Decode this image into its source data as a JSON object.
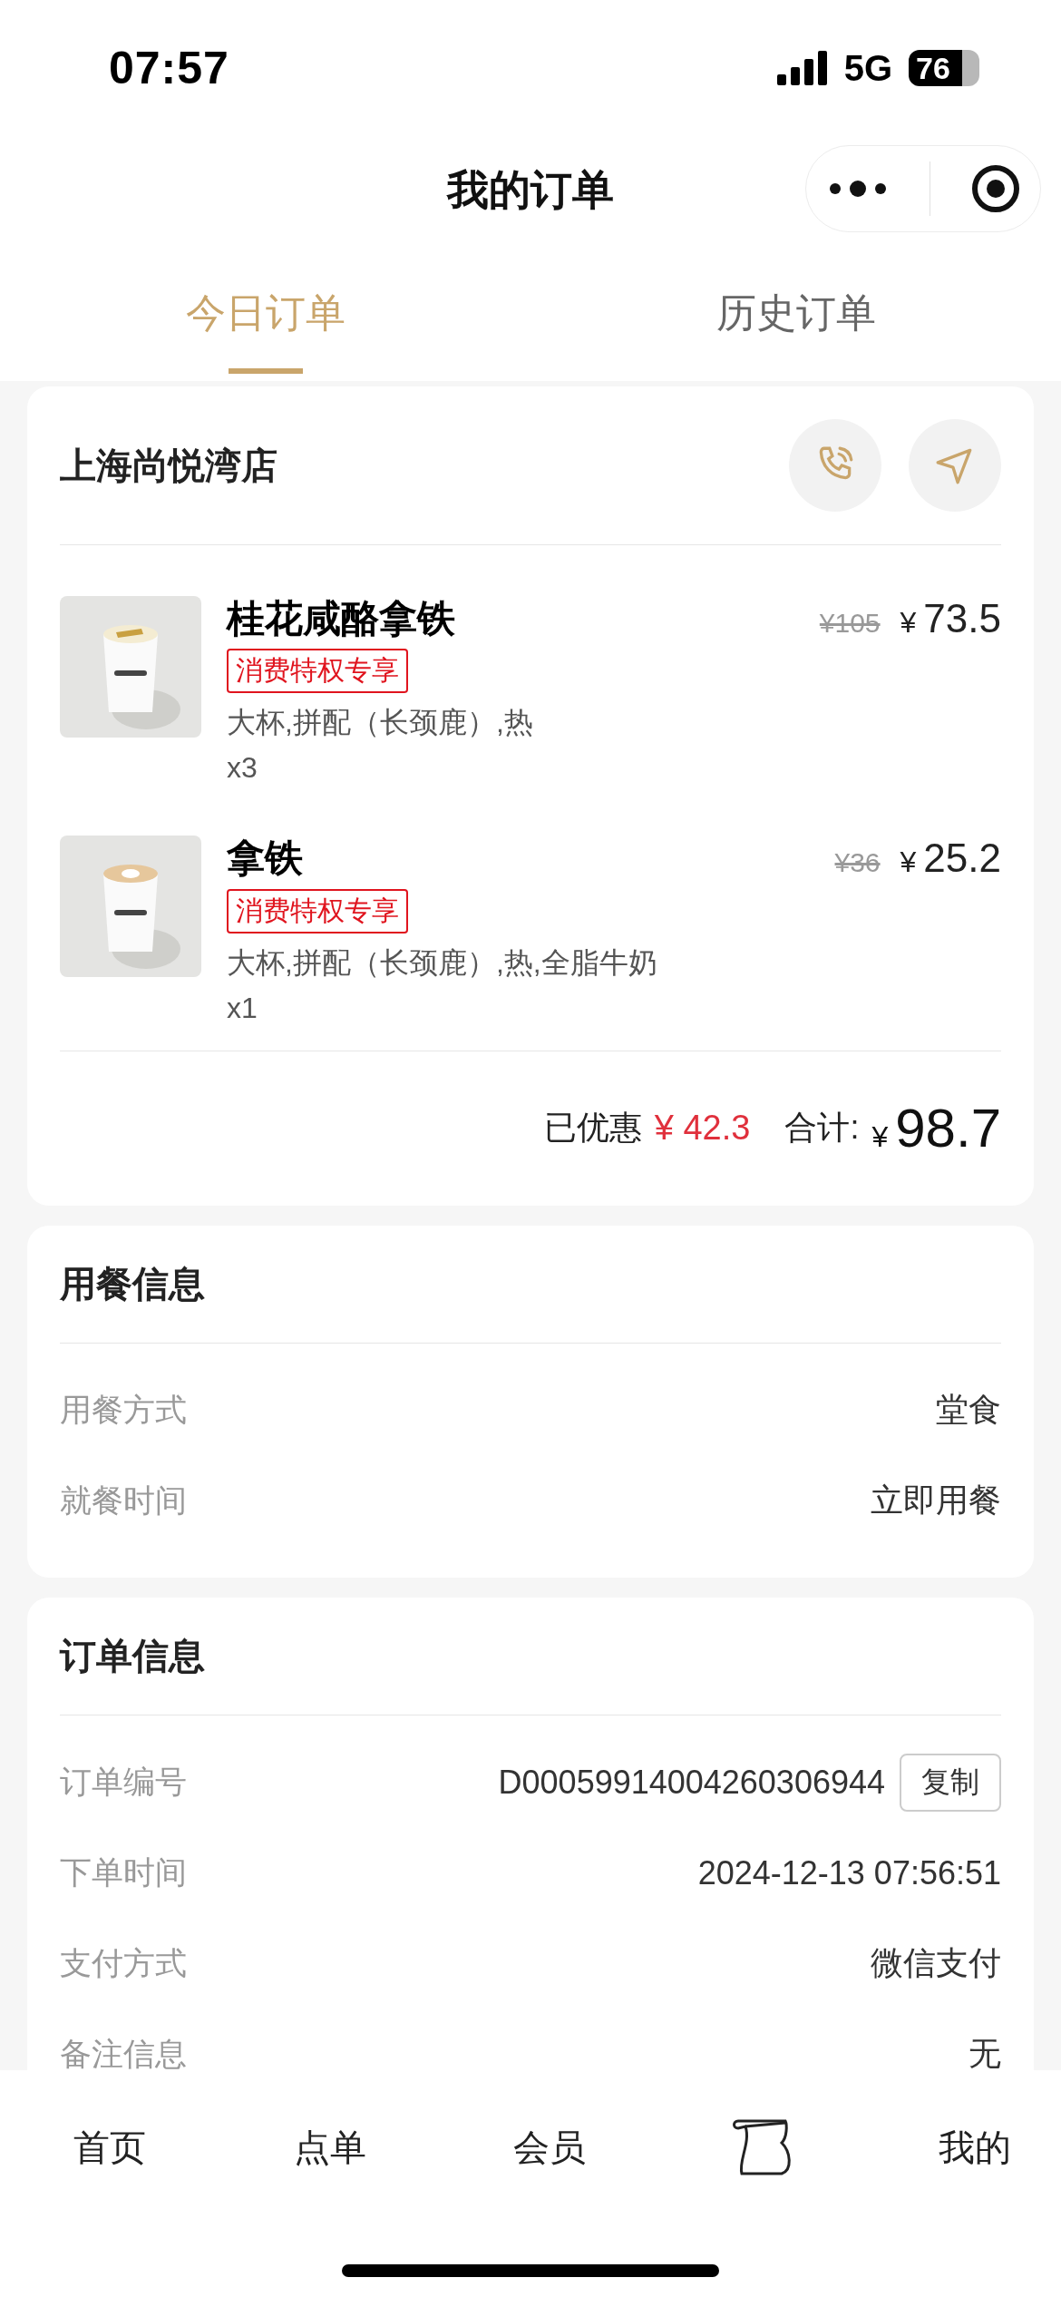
{
  "status_bar": {
    "time": "07:57",
    "network": "5G",
    "battery": "76"
  },
  "header": {
    "title": "我的订单"
  },
  "tabs": [
    {
      "label": "今日订单",
      "selected": true
    },
    {
      "label": "历史订单",
      "selected": false
    }
  ],
  "order": {
    "store": "上海尚悦湾店",
    "items": [
      {
        "name": "桂花咸酪拿铁",
        "tag": "消费特权专享",
        "options": "大杯,拼配（长颈鹿）,热",
        "quantity": "x3",
        "original_price": "¥105",
        "price_symbol": "¥",
        "price": "73.5"
      },
      {
        "name": "拿铁",
        "tag": "消费特权专享",
        "options": "大杯,拼配（长颈鹿）,热,全脂牛奶",
        "quantity": "x1",
        "original_price": "¥36",
        "price_symbol": "¥",
        "price": "25.2"
      }
    ],
    "discount_label": "已优惠",
    "discount": "¥ 42.3",
    "total_label": "合计:",
    "total_symbol": "¥",
    "total": "98.7"
  },
  "dining_info": {
    "title": "用餐信息",
    "rows": [
      {
        "label": "用餐方式",
        "value": "堂食"
      },
      {
        "label": "就餐时间",
        "value": "立即用餐"
      }
    ]
  },
  "order_info": {
    "title": "订单信息",
    "rows": [
      {
        "label": "订单编号",
        "value": "D00059914004260306944",
        "action": "复制"
      },
      {
        "label": "下单时间",
        "value": "2024-12-13 07:56:51"
      },
      {
        "label": "支付方式",
        "value": "微信支付"
      },
      {
        "label": "备注信息",
        "value": "无"
      }
    ]
  },
  "tab_bar": [
    {
      "kind": "label",
      "label": "首页"
    },
    {
      "kind": "label",
      "label": "点单"
    },
    {
      "kind": "label",
      "label": "会员"
    },
    {
      "kind": "icon"
    },
    {
      "kind": "label",
      "label": "我的"
    }
  ]
}
